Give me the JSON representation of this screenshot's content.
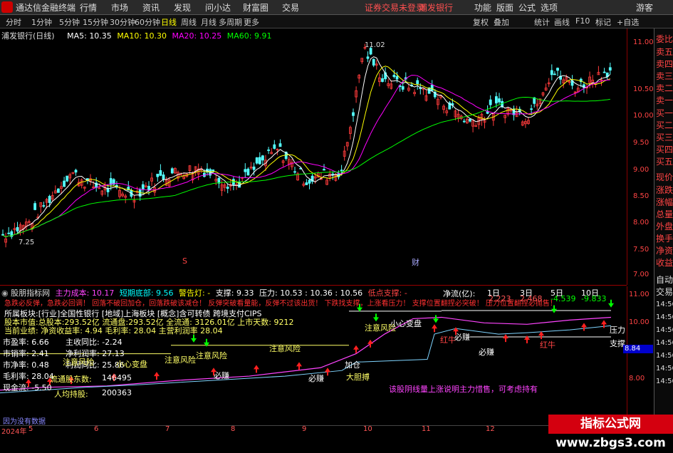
{
  "app": {
    "title": "通达信金融终端"
  },
  "menu": [
    "行情",
    "市场",
    "资讯",
    "发现",
    "问小达",
    "财富圈",
    "交易"
  ],
  "status": {
    "login": "证券交易未登录",
    "stock": "浦发银行"
  },
  "right_menu": [
    "功能",
    "版面",
    "公式",
    "选项",
    "游客"
  ],
  "periods": [
    "分时",
    "1分钟",
    "5分钟",
    "15分钟",
    "30分钟",
    "60分钟",
    "日线",
    "周线",
    "月线",
    "多周期",
    "更多"
  ],
  "active_period": "日线",
  "tools": [
    "复权",
    "叠加",
    "统计",
    "画线",
    "F10",
    "标记",
    "+自选"
  ],
  "quote_panel": [
    "委比",
    "卖五",
    "卖四",
    "卖三",
    "卖二",
    "卖一",
    "买一",
    "买二",
    "买三",
    "买四",
    "买五",
    "现价",
    "涨跌",
    "涨幅",
    "总量",
    "外盘",
    "换手",
    "净资",
    "收益",
    "自动",
    "交易"
  ],
  "price_chart": {
    "stock_label": "浦发银行(日线)",
    "ma": [
      {
        "name": "MA5",
        "value": "10.35",
        "color": "#ffffff"
      },
      {
        "name": "MA10",
        "value": "10.30",
        "color": "#ffff00"
      },
      {
        "name": "MA20",
        "value": "10.25",
        "color": "#ff00ff"
      },
      {
        "name": "MA60",
        "value": "9.91",
        "color": "#00ff00"
      }
    ],
    "y_ticks": [
      "11.00",
      "10.50",
      "10.00",
      "9.50",
      "9.00",
      "8.50",
      "8.00",
      "7.50",
      "7.00"
    ],
    "high_label": "11.02",
    "low_label": "7.25",
    "markers": [
      "S",
      "财"
    ]
  },
  "indicator": {
    "name": "股朋指标网",
    "fields": [
      {
        "label": "主力成本:",
        "value": "10.17",
        "color": "#ff44ff"
      },
      {
        "label": "短期底部:",
        "value": "9.56",
        "color": "#00ffff"
      },
      {
        "label": "警告灯:",
        "value": "-",
        "color": "#ffff00"
      },
      {
        "label": "支撑:",
        "value": "9.33",
        "color": "#ffffff"
      },
      {
        "label": "压力:",
        "value": "10.53",
        "color": "#ffffff"
      },
      {
        "label": "",
        "value": "10.36",
        "color": "#ffffff"
      },
      {
        "label": "",
        "value": "10.56",
        "color": "#ffffff"
      },
      {
        "label": "低点支撑:",
        "value": "-",
        "color": "#ff4444"
      }
    ],
    "hints": "急跌必反弹，急跌必回调！ 回落不破回加仓，回落跌破该减仓！ 反弹突破看量能，反弹不过该出货！ 下跌找支撑，上涨看压力！ 支撑位置翻捏必突破！ 压力位置翻捏必抛售！",
    "y_ticks": [
      "11.00",
      "10.00",
      "9.00",
      "8.00"
    ],
    "right_values": [
      "14:56",
      "14:56",
      "14:56",
      "14:56",
      "14:56",
      "14:56",
      "14:56"
    ],
    "price_box": "8.84",
    "signals": [
      "注意风险",
      "小心变盘",
      "注意风险",
      "注意风险",
      "注意风险",
      "必赚",
      "必赚",
      "必赚",
      "红牛",
      "红牛",
      "必赚",
      "加仓",
      "大胆搏",
      "压力",
      "支撑",
      "注意风险",
      "小心变盘"
    ]
  },
  "fundamentals": {
    "line1": "所属板块:[行业]全国性银行 [地域]上海板块 [概念]含可转债 跨境支付CIPS",
    "line2": "股本市值:总股本:293.52亿 流通盘:293.52亿 全流通: 3126.01亿 上市天数: 9212",
    "line3": "当前业绩: 净资收益率: 4.94 毛利率: 28.04 主营利润率 28.04",
    "metrics_left": [
      {
        "label": "市盈率:",
        "value": "6.66"
      },
      {
        "label": "市销率:",
        "value": "2.41"
      },
      {
        "label": "市净率:",
        "value": "0.48"
      },
      {
        "label": "毛利率:",
        "value": "28.04"
      },
      {
        "label": "现金流:",
        "value": "-5.50"
      }
    ],
    "metrics_right": [
      {
        "label": "主收同比:",
        "value": "-2.24"
      },
      {
        "label": "净利润率:",
        "value": "27.13"
      },
      {
        "label": "利润同比:",
        "value": "25.86"
      }
    ]
  },
  "net_flow": {
    "label": "净流(亿):",
    "headers": [
      "1日",
      "3日",
      "5日",
      "10日"
    ],
    "values": [
      "2.223",
      "2.468",
      "-4.539",
      "-9.833"
    ]
  },
  "holders": [
    {
      "label": "流通股东数:",
      "value": "146495"
    },
    {
      "label": "人均持股:",
      "value": "200363"
    }
  ],
  "bottom_note": "该股阴线量上涨说明主力惜售，可考虑持有",
  "data_notice": "因为没有数据",
  "x_dates": [
    "2024年",
    "5",
    "6",
    "7",
    "8",
    "9",
    "10",
    "11",
    "12"
  ],
  "watermark": "指标公式网 www.zbgs3.com"
}
